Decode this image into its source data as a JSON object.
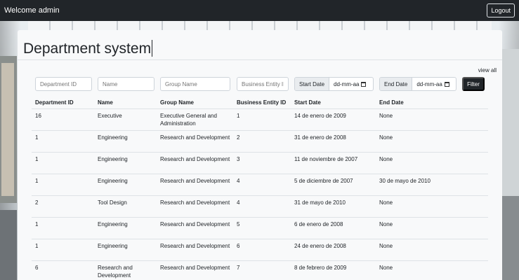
{
  "navbar": {
    "brand": "Welcome admin",
    "logout_label": "Logout"
  },
  "page": {
    "title": "Department system",
    "view_all": "view all"
  },
  "filters": {
    "department_id_placeholder": "Department ID",
    "name_placeholder": "Name",
    "group_name_placeholder": "Group Name",
    "business_entity_placeholder": "Business Entity II",
    "start_date_label": "Start Date",
    "start_date_value": "dd-mm-aa",
    "end_date_label": "End Date",
    "end_date_value": "dd-mm-aa",
    "filter_label": "Filter"
  },
  "table": {
    "columns": [
      "Department ID",
      "Name",
      "Group Name",
      "Business Entity ID",
      "Start Date",
      "End Date"
    ],
    "rows": [
      [
        "16",
        "Executive",
        "Executive General and Administration",
        "1",
        "14 de enero de 2009",
        "None"
      ],
      [
        "1",
        "Engineering",
        "Research and Development",
        "2",
        "31 de enero de 2008",
        "None"
      ],
      [
        "1",
        "Engineering",
        "Research and Development",
        "3",
        "11 de noviembre de 2007",
        "None"
      ],
      [
        "1",
        "Engineering",
        "Research and Development",
        "4",
        "5 de diciembre de 2007",
        "30 de mayo de 2010"
      ],
      [
        "2",
        "Tool Design",
        "Research and Development",
        "4",
        "31 de mayo de 2010",
        "None"
      ],
      [
        "1",
        "Engineering",
        "Research and Development",
        "5",
        "6 de enero de 2008",
        "None"
      ],
      [
        "1",
        "Engineering",
        "Research and Development",
        "6",
        "24 de enero de 2008",
        "None"
      ],
      [
        "6",
        "Research and Development",
        "Research and Development",
        "7",
        "8 de febrero de 2009",
        "None"
      ]
    ]
  },
  "colors": {
    "navbar_bg": "#212529",
    "card_bg": "#f8f9fa",
    "filter_button_bg": "#212529"
  },
  "icons": {
    "date_picker": "calendar-icon"
  }
}
